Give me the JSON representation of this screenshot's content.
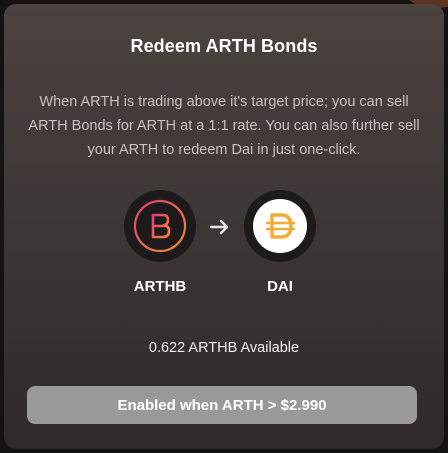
{
  "modal": {
    "title": "Redeem ARTH Bonds",
    "description": "When ARTH is trading above it's target price; you can sell ARTH Bonds for ARTH at a 1:1 rate. You can also further sell your ARTH to redeem Dai in just one-click."
  },
  "swap": {
    "from": {
      "symbol": "ARTHB",
      "icon": "arthb-token-icon"
    },
    "arrow_icon": "arrow-right-icon",
    "to": {
      "symbol": "DAI",
      "icon": "dai-token-icon"
    }
  },
  "balance": {
    "available_text": "0.622 ARTHB Available"
  },
  "action": {
    "button_label": "Enabled when ARTH > $2.990"
  },
  "colors": {
    "card_top": "#4a4340",
    "card_bottom": "#2f2a28",
    "description_text": "#c9c2be",
    "arthb_gradient_start": "#e33b7a",
    "arthb_gradient_end": "#f6892f",
    "dai_yellow": "#f5ac37",
    "button_disabled": "#9b9998"
  }
}
